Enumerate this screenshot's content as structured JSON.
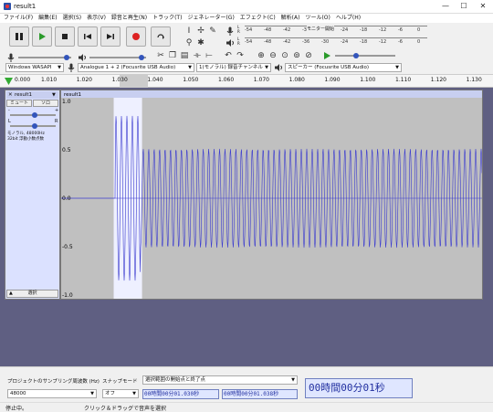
{
  "window": {
    "title": "result1",
    "minimize": "—",
    "maximize": "☐",
    "close": "✕"
  },
  "menu": [
    "ファイル(F)",
    "編集(E)",
    "選択(S)",
    "表示(V)",
    "録音と再生(N)",
    "トラック(T)",
    "ジェネレーター(G)",
    "エフェクト(C)",
    "解析(A)",
    "ツール(O)",
    "ヘルプ(H)"
  ],
  "meters": {
    "record_ticks": [
      "-54",
      "-48",
      "-42",
      "-36",
      "-30",
      "-24",
      "-18",
      "-12",
      "-6",
      "0"
    ],
    "record_click_hint": "モニター開始",
    "play_ticks": [
      "-54",
      "-48",
      "-42",
      "-36",
      "-30",
      "-24",
      "-18",
      "-12",
      "-6",
      "0"
    ]
  },
  "devices": {
    "host": "Windows WASAPI",
    "input": "Analogue 1 + 2 (Focusrite USB Audio)",
    "channels": "1(モノラル) 録音チャンネル",
    "output": "スピーカー (Focusrite USB Audio)"
  },
  "ruler": {
    "labels": [
      "0.000",
      "1.010",
      "1.020",
      "1.030",
      "1.040",
      "1.050",
      "1.060",
      "1.070",
      "1.080",
      "1.090",
      "1.100",
      "1.110",
      "1.120",
      "1.130"
    ]
  },
  "track": {
    "name": "result1",
    "close": "✕",
    "menu_name": "result1",
    "mute": "ミュート",
    "solo": "ソロ",
    "gain_min": "-",
    "gain_max": "+",
    "pan_left": "L",
    "pan_right": "R",
    "info": "モノラル, 48000Hz\n32bit 浮動小数点数",
    "select": "選択",
    "clip_name": "result1",
    "yaxis": [
      "1.0",
      "0.5",
      "0.0",
      "-0.5",
      "-1.0"
    ]
  },
  "bottom": {
    "rate_label": "プロジェクトのサンプリング周波数 (Hz)",
    "rate_value": "48000",
    "snap_label": "スナップモード",
    "snap_value": "オフ",
    "selection_mode": "選択範囲の開始点と終了点",
    "sel_start": "00時間00分01.030秒",
    "sel_end": "00時間00分01.038秒",
    "position": "00時間00分01秒"
  },
  "status": {
    "state": "停止中。",
    "hint": "クリック＆ドラッグで音声を選択"
  },
  "colors": {
    "wave": "#3a3acf",
    "selection": "#ffffff",
    "track_bg": "#c0c0c0",
    "accent": "#3355bb"
  },
  "waveform": {
    "segments": [
      {
        "from_time": 1.0,
        "to_time": 1.031,
        "amplitude": 0.0
      },
      {
        "from_time": 1.031,
        "to_time": 1.038,
        "amplitude": 0.5
      },
      {
        "from_time": 1.038,
        "to_time": 1.139,
        "amplitude": 0.3
      }
    ],
    "cycles_per_ms": 0.65
  }
}
